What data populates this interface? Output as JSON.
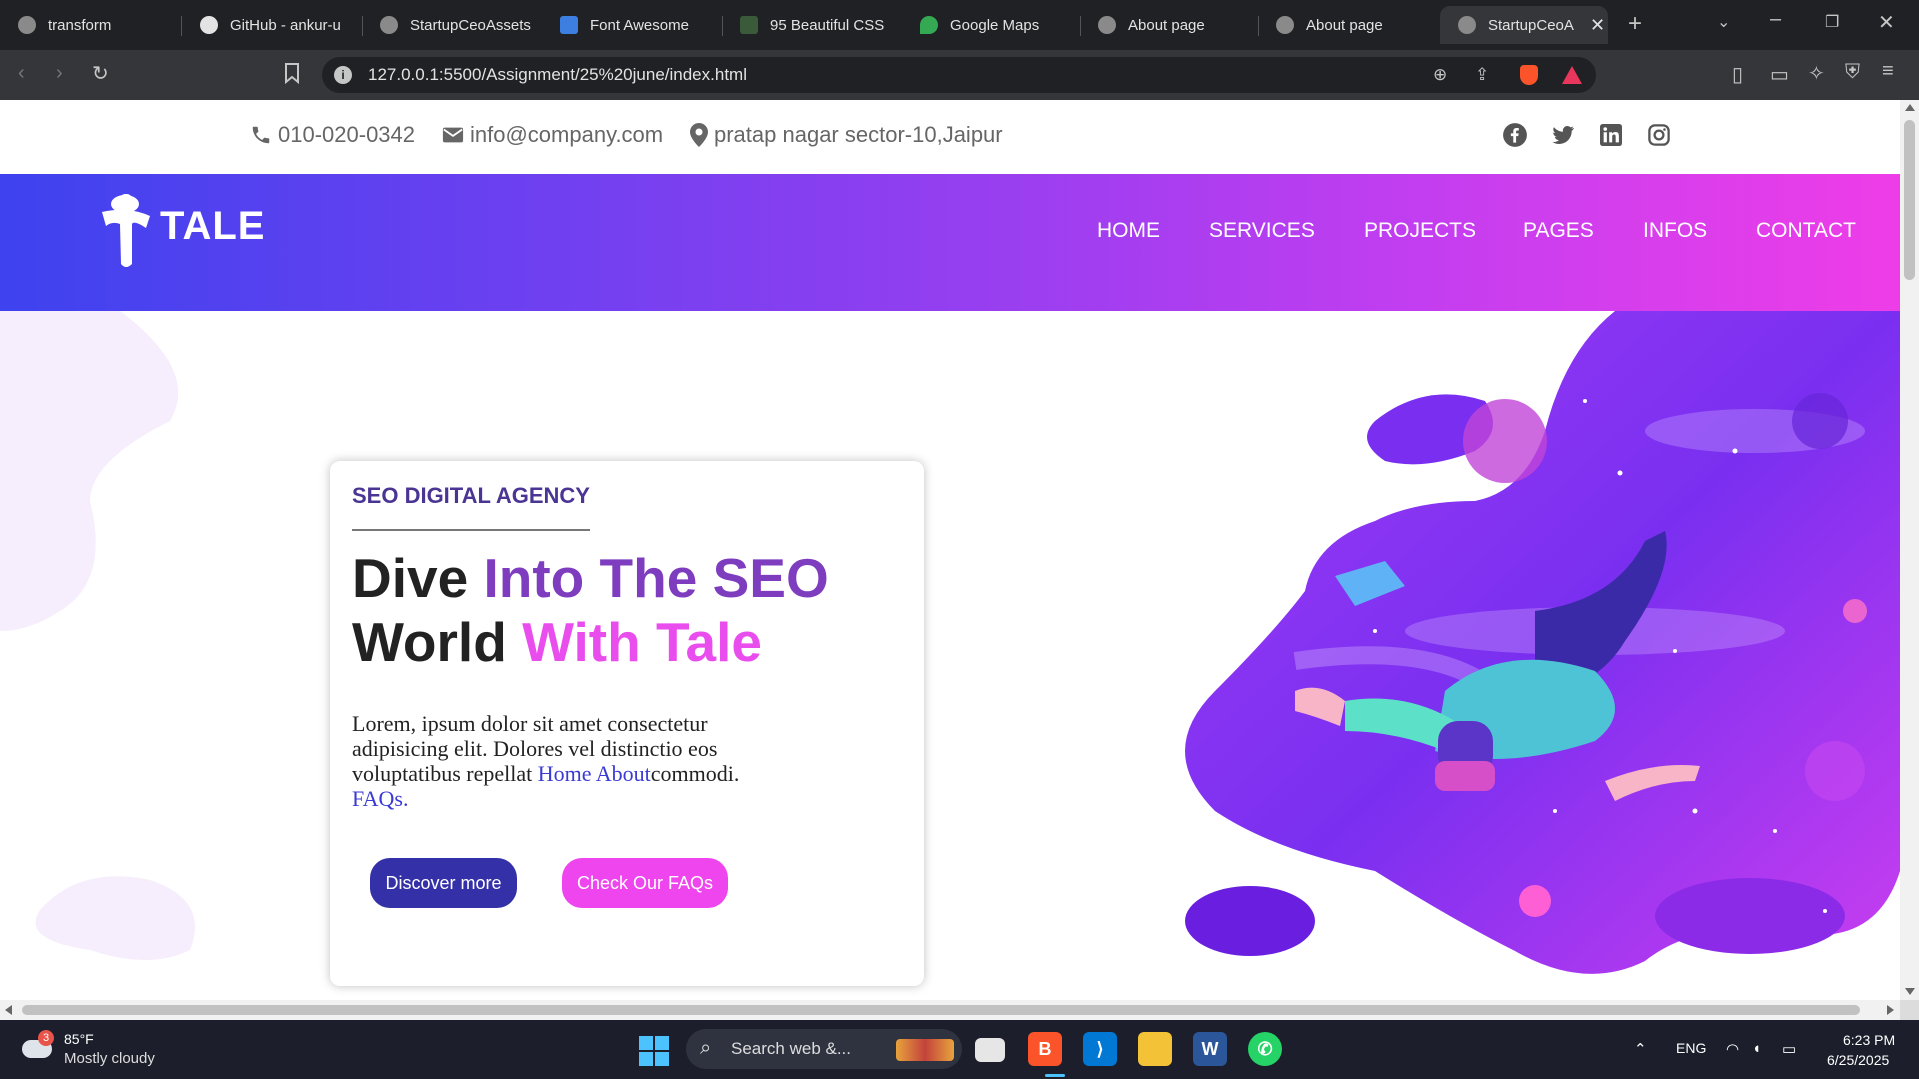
{
  "browser": {
    "tabs": [
      {
        "label": "transform"
      },
      {
        "label": "GitHub - ankur-u"
      },
      {
        "label": "StartupCeoAssets"
      },
      {
        "label": "Font Awesome"
      },
      {
        "label": "95 Beautiful CSS"
      },
      {
        "label": "Google Maps"
      },
      {
        "label": "About page"
      },
      {
        "label": "About page"
      },
      {
        "label": "StartupCeoA"
      }
    ],
    "url": "127.0.0.1:5500/Assignment/25%20june/index.html"
  },
  "topinfo": {
    "phone": "010-020-0342",
    "email": "info@company.com",
    "address": "pratap nagar sector-10,Jaipur"
  },
  "nav": {
    "logo": "TALE",
    "items": [
      "HOME",
      "SERVICES",
      "PROJECTS",
      "PAGES",
      "INFOS",
      "CONTACT"
    ]
  },
  "hero": {
    "kicker": "SEO DIGITAL AGENCY",
    "headline_1": "Dive ",
    "headline_2": "Into The SEO",
    "headline_3": "World ",
    "headline_4": "With Tale",
    "para_text": "Lorem, ipsum dolor sit amet consectetur adipisicing elit. Dolores vel distinctio eos voluptatibus repellat ",
    "link_home": "Home",
    "link_about": "About",
    "para_tail": "commodi.",
    "link_faqs": "FAQs.",
    "btn_discover": "Discover more",
    "btn_faqs": "Check Our FAQs"
  },
  "taskbar": {
    "weather_temp": "85°F",
    "weather_desc": "Mostly cloudy",
    "weather_badge": "3",
    "search_placeholder": "Search web &...",
    "lang": "ENG",
    "time": "6:23 PM",
    "date": "6/25/2025"
  },
  "colors": {
    "nav_gradient_start": "#3e42ef",
    "nav_gradient_end": "#ee3de8",
    "kicker": "#4b3594",
    "headline_purple": "#7e3cbf",
    "headline_pink": "#ea4ded",
    "btn_dark": "#3430a8",
    "btn_pink": "#ee45ee"
  }
}
